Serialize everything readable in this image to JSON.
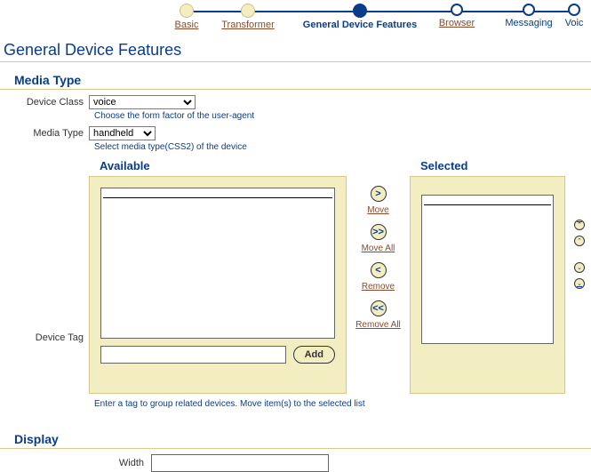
{
  "wizard": {
    "steps": [
      {
        "label": "Basic"
      },
      {
        "label": "Transformer"
      },
      {
        "label": "General Device Features"
      },
      {
        "label": "Browser"
      },
      {
        "label": "Messaging"
      },
      {
        "label": "Voic"
      }
    ]
  },
  "page_title": "General Device Features",
  "media_type_section": "Media Type",
  "device_class": {
    "label": "Device Class",
    "value": "voice",
    "help": "Choose the form factor of the user-agent"
  },
  "media_type": {
    "label": "Media Type",
    "value": "handheld",
    "help": "Select media type(CSS2) of the device"
  },
  "device_tag": {
    "label": "Device Tag",
    "available_head": "Available",
    "selected_head": "Selected",
    "add_label": "Add",
    "tag_value": "",
    "tag_placeholder": "",
    "move": "Move",
    "move_all": "Move All",
    "remove": "Remove",
    "remove_all": "Remove All",
    "enter_help": "Enter a tag to group related devices. Move item(s) to the selected list"
  },
  "display_section": "Display",
  "width": {
    "label": "Width",
    "value": ""
  },
  "icons": {
    "right": ">",
    "dright": ">>",
    "left": "<",
    "dleft": "<<",
    "top": "⌃",
    "up": "⌃",
    "down": "⌄",
    "bottom": "⌄"
  }
}
